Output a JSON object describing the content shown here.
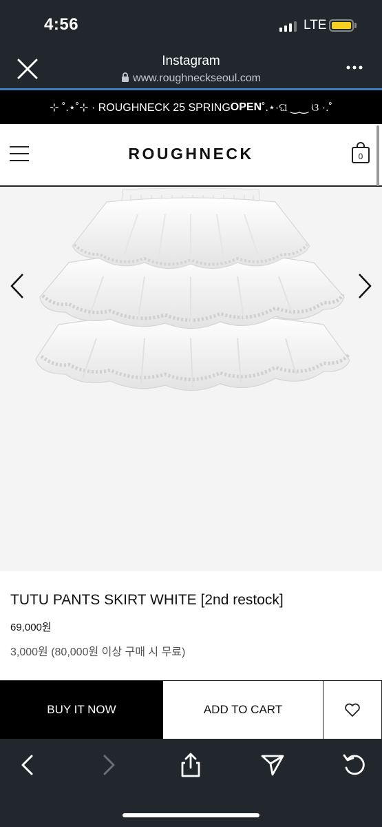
{
  "status_bar": {
    "time": "4:56",
    "network": "LTE",
    "battery_color": "#f5d020"
  },
  "browser": {
    "title": "Instagram",
    "url": "www.roughneckseoul.com",
    "accent_color": "#3d7fc1"
  },
  "announcement": {
    "prefix": "⊹ ˚.⋆˚⊹ · ROUGHNECK 25 SPRING ",
    "highlight": "OPEN",
    "suffix": "˚.⋆·ଘ ‿‿ ଓ ·.˚"
  },
  "site": {
    "logo": "ROUGHNECK",
    "cart_count": "0"
  },
  "product": {
    "name": "TUTU PANTS SKIRT WHITE [2nd restock]",
    "price": "69,000원",
    "shipping": "3,000원 (80,000원 이상 구매 시 무료)"
  },
  "actions": {
    "buy_now": "BUY IT NOW",
    "add_to_cart": "ADD TO CART"
  },
  "icons": {
    "close": "close-icon",
    "more": "more-icon",
    "lock": "lock-icon",
    "menu": "menu-icon",
    "cart": "shopping-bag-icon",
    "prev": "chevron-left-icon",
    "next": "chevron-right-icon",
    "wishlist": "heart-icon",
    "back": "back-icon",
    "forward": "forward-icon",
    "share": "share-icon",
    "send": "send-icon",
    "reload": "reload-icon"
  }
}
